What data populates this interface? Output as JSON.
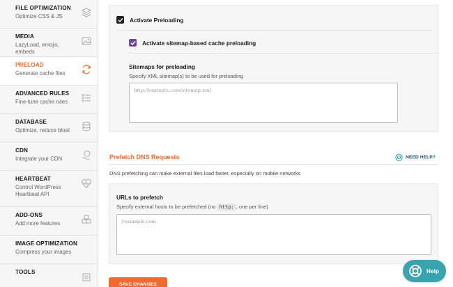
{
  "colors": {
    "accent": "#f06a2f",
    "checkbox_dark": "#1d2327",
    "checkbox_purple": "#6b4c9a",
    "help_bubble": "#3aa3b0"
  },
  "sidebar": {
    "items": [
      {
        "title": "FILE OPTIMIZATION",
        "subtitle": "Optimize CSS & JS",
        "icon": "layers-icon"
      },
      {
        "title": "MEDIA",
        "subtitle": "LazyLoad, emojis, embeds",
        "icon": "image-icon"
      },
      {
        "title": "PRELOAD",
        "subtitle": "Generate cache files",
        "icon": "refresh-icon",
        "active": true
      },
      {
        "title": "ADVANCED RULES",
        "subtitle": "Fine-tune cache rules",
        "icon": "list-icon"
      },
      {
        "title": "DATABASE",
        "subtitle": "Optimize, reduce bloat",
        "icon": "database-icon"
      },
      {
        "title": "CDN",
        "subtitle": "Integrate your CDN",
        "icon": "cdn-icon"
      },
      {
        "title": "HEARTBEAT",
        "subtitle": "Control WordPress Heartbeat API",
        "icon": "heartbeat-icon"
      },
      {
        "title": "ADD-ONS",
        "subtitle": "Add more features",
        "icon": "addons-icon"
      },
      {
        "title": "IMAGE OPTIMIZATION",
        "subtitle": "Compress your images",
        "icon": ""
      },
      {
        "title": "TOOLS",
        "subtitle": "",
        "icon": "tools-icon"
      }
    ]
  },
  "preload": {
    "activate_label": "Activate Preloading",
    "sitemap_label": "Activate sitemap-based cache preloading",
    "sitemaps_title": "Sitemaps for preloading",
    "sitemaps_desc": "Specify XML sitemap(s) to be used for preloading",
    "sitemaps_placeholder": "http://example.com/sitemap.xml"
  },
  "prefetch": {
    "title": "Prefetch DNS Requests",
    "need_help": "NEED HELP?",
    "desc": "DNS prefetching can make external files load faster, especially on mobile networks",
    "urls_title": "URLs to prefetch",
    "urls_desc_before": "Specify external hosts to be prefetched (no",
    "urls_desc_code": "http:",
    "urls_desc_after": ", one per line)",
    "urls_placeholder": "//example.com"
  },
  "save_button": "SAVE CHANGES",
  "help_bubble": "Help"
}
